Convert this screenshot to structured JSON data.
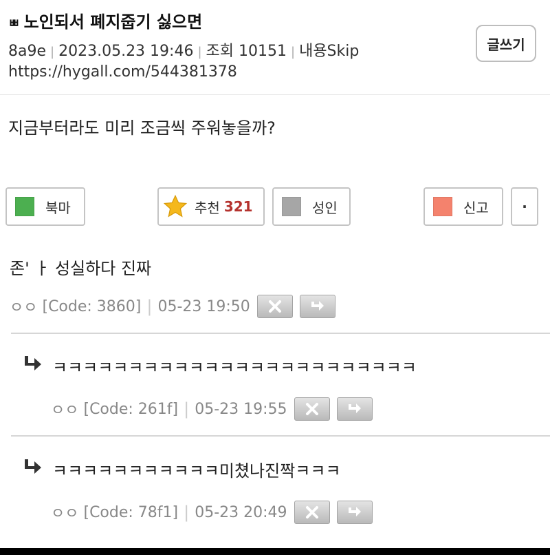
{
  "post": {
    "title_prefix": "ㅃ",
    "title": "노인되서 폐지줍기 싫으면",
    "author": "8a9e",
    "date": "2023.05.23 19:46",
    "views": "조회 10151",
    "skip": "내용Skip",
    "url": "https://hygall.com/544381378",
    "body": "지금부터라도 미리 조금씩 주워놓을까?"
  },
  "header": {
    "write_label": "글쓰기"
  },
  "actions": {
    "bookmark_label": "북마",
    "recommend_label": "추천",
    "recommend_count": "321",
    "adult_label": "성인",
    "report_label": "신고",
    "more_label": "·"
  },
  "colors": {
    "bookmark": "#4caf50",
    "star": "#f5b81c",
    "adult": "#a6a6a6",
    "report": "#f4826d",
    "recommend_count": "#b5322e"
  },
  "comments": [
    {
      "text": "존' ㅏ 성실하다 진짜",
      "prefix": "ㅇㅇ",
      "code": "[Code: 3860]",
      "time": "05-23 19:50",
      "reply": false
    },
    {
      "text": "ㅋㅋㅋㅋㅋㅋㅋㅋㅋㅋㅋㅋㅋㅋㅋㅋㅋㅋㅋㅋㅋㅋㅋㅋ",
      "prefix": "ㅇㅇ",
      "code": "[Code: 261f]",
      "time": "05-23 19:55",
      "reply": true
    },
    {
      "text": "ㅋㅋㅋㅋㅋㅋㅋㅋㅋㅋㅋ미쳤나진짝ㅋㅋㅋ",
      "prefix": "ㅇㅇ",
      "code": "[Code: 78f1]",
      "time": "05-23 20:49",
      "reply": true
    }
  ]
}
